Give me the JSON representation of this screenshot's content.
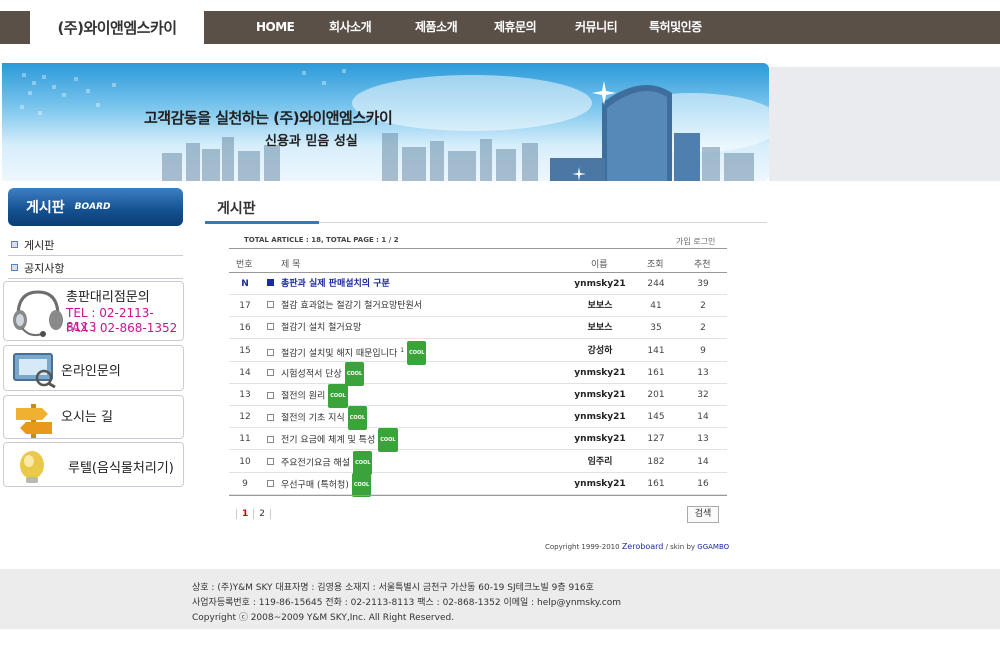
{
  "header": {
    "logo_text": "(주)와이앤엠스카이",
    "nav": [
      "HOME",
      "회사소개",
      "제품소개",
      "제휴문의",
      "커뮤니티",
      "특허및인증"
    ]
  },
  "banner": {
    "slogan1": "고객감동을 실천하는 (주)와이앤엠스카이",
    "slogan2": "신용과 믿음  성실"
  },
  "sidebar": {
    "board_title": "게시판",
    "board_sub": "BOARD",
    "items": [
      "게시판",
      "공지사항"
    ],
    "contact": {
      "title": "총판대리점문의",
      "tel": "TEL : 02-2113-8113",
      "fax": "FAX : 02-868-1352"
    },
    "online": "온라인문의",
    "directions": "오시는 길",
    "rutel": "루텔(음식물처리기)"
  },
  "board": {
    "title": "게시판",
    "total": "TOTAL ARTICLE : 18, TOTAL PAGE : 1 / 2",
    "login_links": "가입 로그인",
    "headers": {
      "no": "번호",
      "subject": "제  목",
      "name": "이름",
      "hits": "조회",
      "votes": "추천"
    },
    "rows": [
      {
        "no": "N",
        "subject": "총판과 실제 판매설치의 구분",
        "name": "ynmsky21",
        "hits": "244",
        "votes": "39",
        "cool": false,
        "extra": ""
      },
      {
        "no": "17",
        "subject": "절감 효과없는 절감기 철거요망탄원서",
        "name": "보보스",
        "hits": "41",
        "votes": "2",
        "cool": false,
        "extra": ""
      },
      {
        "no": "16",
        "subject": "절감기 설치 철거요망",
        "name": "보보스",
        "hits": "35",
        "votes": "2",
        "cool": false,
        "extra": ""
      },
      {
        "no": "15",
        "subject": "절감기 설치및 해지 때문입니다",
        "name": "강성하",
        "hits": "141",
        "votes": "9",
        "cool": true,
        "extra": "1"
      },
      {
        "no": "14",
        "subject": "시험성적서 단상",
        "name": "ynmsky21",
        "hits": "161",
        "votes": "13",
        "cool": true,
        "extra": ""
      },
      {
        "no": "13",
        "subject": "절전의 원리",
        "name": "ynmsky21",
        "hits": "201",
        "votes": "32",
        "cool": true,
        "extra": ""
      },
      {
        "no": "12",
        "subject": "절전의 기초 지식",
        "name": "ynmsky21",
        "hits": "145",
        "votes": "14",
        "cool": true,
        "extra": ""
      },
      {
        "no": "11",
        "subject": "전기 요금에 체계 및 특성",
        "name": "ynmsky21",
        "hits": "127",
        "votes": "13",
        "cool": true,
        "extra": ""
      },
      {
        "no": "10",
        "subject": "주요전기요금 해설",
        "name": "임주리",
        "hits": "182",
        "votes": "14",
        "cool": true,
        "extra": ""
      },
      {
        "no": "9",
        "subject": "우선구매 (특허청)",
        "name": "ynmsky21",
        "hits": "161",
        "votes": "16",
        "cool": true,
        "extra": ""
      }
    ],
    "cool_label": "COOL",
    "pages": [
      "1",
      "2"
    ],
    "search_button": "검색",
    "copyright_pre": "Copyright 1999-2010",
    "copyright_zb": "Zeroboard",
    "copyright_post": "/ skin by",
    "copyright_skin": "GGAMBO"
  },
  "footer": {
    "line1": "상호 : (주)Y&M SKY    대표자명 : 김영용    소재지 : 서울특별시 금천구 가산동 60-19 SJ테크노빌 9층 916호",
    "line2": "사업자등록번호 : 119-86-15645    전화 : 02-2113-8113    팩스 : 02-868-1352    이메일 : help@ynmsky.com",
    "line3": "Copyright ⓒ 2008~2009 Y&M SKY,Inc. All Right Reserved."
  },
  "colors": {
    "nav_bg": "#5a5048",
    "accent_blue": "#2f7bc6",
    "notice_blue": "#1a2aa0",
    "cool_green": "#3aa43a",
    "contact_pink": "#c8158f"
  }
}
